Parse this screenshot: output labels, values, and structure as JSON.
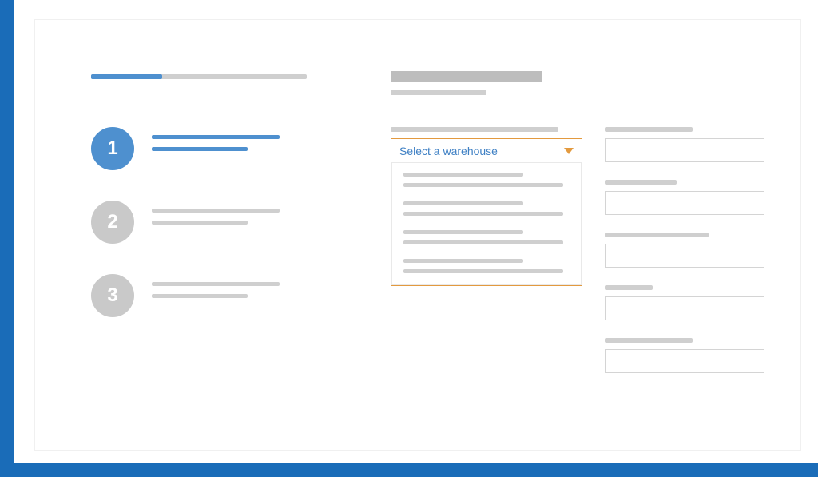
{
  "progress": {
    "percent": 33
  },
  "steps": [
    {
      "number": "1",
      "active": true
    },
    {
      "number": "2",
      "active": false
    },
    {
      "number": "3",
      "active": false
    }
  ],
  "dropdown": {
    "placeholder": "Select a warehouse"
  },
  "colors": {
    "frame": "#1a6cb8",
    "accent": "#4e90cf",
    "dropdownBorder": "#e39a3f",
    "placeholderText": "#3f80c4",
    "skeleton": "#cfcfcf"
  }
}
